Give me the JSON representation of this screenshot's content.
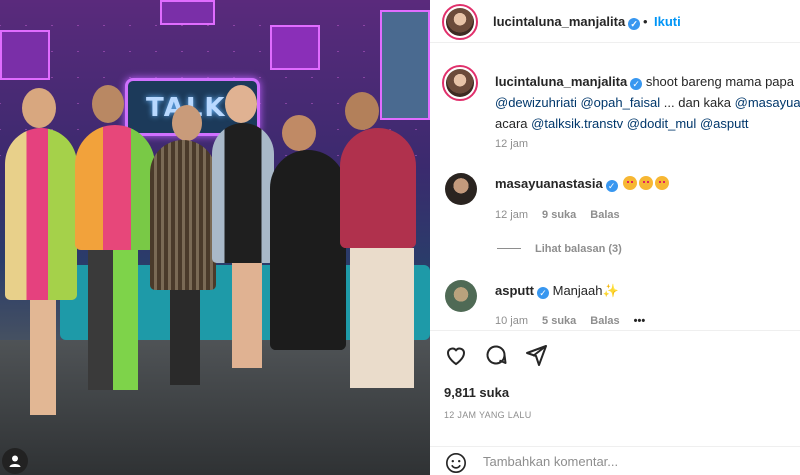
{
  "photo": {
    "sign_text": "TALKS",
    "description_icon": "person-icon"
  },
  "header": {
    "username": "lucintaluna_manjalita",
    "separator": "•",
    "follow_label": "Ikuti"
  },
  "caption": {
    "username": "lucintaluna_manjalita",
    "line1_text": "shoot bareng mama papa",
    "line2": [
      "@dewizuhriati",
      "@opah_faisal",
      "... dan kaka",
      "@masayua"
    ],
    "line3_prefix": "acara",
    "line3_mentions": [
      "@talksik.transtv",
      "@dodit_mul",
      "@asputt"
    ],
    "time": "12 jam"
  },
  "comments": [
    {
      "username": "masayuanastasia",
      "text": "",
      "emoji": "heart-eyes-emoji",
      "time": "12 jam",
      "likes": "9 suka",
      "reply": "Balas",
      "view_replies": "Lihat balasan (3)"
    },
    {
      "username": "asputt",
      "text": "Manjaah",
      "emoji": "sparkles-emoji",
      "time": "10 jam",
      "likes": "5 suka",
      "reply": "Balas",
      "more": "•••"
    }
  ],
  "actions": {
    "likes_count": "9,811 suka",
    "posted_ago": "12 JAM YANG LALU",
    "comment_placeholder": "Tambahkan komentar..."
  },
  "colors": {
    "link": "#00376b",
    "follow": "#0095f6",
    "verified": "#3897f0",
    "muted": "#8e8e8e"
  }
}
